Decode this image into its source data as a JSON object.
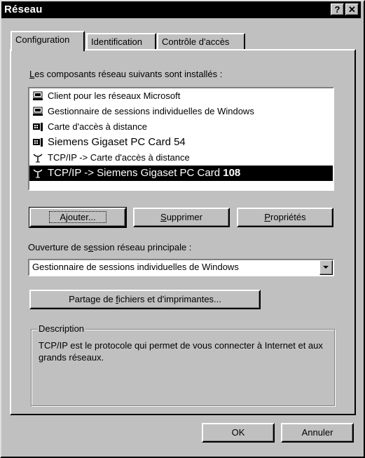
{
  "window": {
    "title": "Réseau",
    "help_glyph": "?",
    "close_glyph": "✕"
  },
  "tabs": [
    {
      "label": "Configuration",
      "active": true
    },
    {
      "label": "Identification",
      "active": false
    },
    {
      "label": "Contrôle d'accès",
      "active": false
    }
  ],
  "components": {
    "label_prefix": "L",
    "label_rest": "es composants réseau suivants sont installés :",
    "items": [
      {
        "label": "Client pour les réseaux Microsoft",
        "icon": "computer-icon"
      },
      {
        "label": "Gestionnaire de sessions individuelles de Windows",
        "icon": "computer-icon"
      },
      {
        "label": "Carte d'accès à distance",
        "icon": "network-card-icon"
      },
      {
        "label": "Siemens Gigaset PC Card 54",
        "icon": "network-card-icon"
      },
      {
        "label": "TCP/IP -> Carte d'accès à distance",
        "icon": "protocol-icon"
      },
      {
        "label_main": "TCP/IP -> Siemens Gigaset PC Card ",
        "label_bold": "108",
        "icon": "protocol-icon",
        "selected": true
      }
    ]
  },
  "buttons": {
    "add_pre": "A",
    "add_ul": "j",
    "add_post": "outer...",
    "remove_ul": "S",
    "remove_post": "upprimer",
    "properties_ul": "P",
    "properties_post": "ropriétés",
    "share_pre": "Partage de ",
    "share_ul": "f",
    "share_post": "ichiers et d'imprimantes...",
    "ok": "OK",
    "cancel": "Annuler"
  },
  "logon": {
    "label_pre": "Ouverture de s",
    "label_ul": "e",
    "label_post": "ssion réseau principale :",
    "selected": "Gestionnaire de sessions individuelles de Windows"
  },
  "description": {
    "legend": "Description",
    "text": "TCP/IP est le protocole qui permet de vous connecter à Internet et aux grands réseaux."
  }
}
